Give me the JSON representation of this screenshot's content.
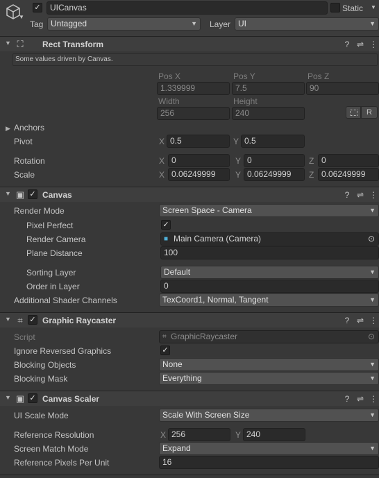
{
  "object": {
    "name": "UICanvas",
    "static_label": "Static",
    "tag_label": "Tag",
    "tag_value": "Untagged",
    "layer_label": "Layer",
    "layer_value": "UI"
  },
  "rect_transform": {
    "title": "Rect Transform",
    "notice": "Some values driven by Canvas.",
    "pos_x_label": "Pos X",
    "pos_y_label": "Pos Y",
    "pos_z_label": "Pos Z",
    "pos_x": "1.339999",
    "pos_y": "7.5",
    "pos_z": "90",
    "width_label": "Width",
    "height_label": "Height",
    "width": "256",
    "height": "240",
    "r_button": "R",
    "anchors_label": "Anchors",
    "pivot_label": "Pivot",
    "pivot_x": "0.5",
    "pivot_y": "0.5",
    "rotation_label": "Rotation",
    "rot_x": "0",
    "rot_y": "0",
    "rot_z": "0",
    "scale_label": "Scale",
    "scale_x": "0.06249999",
    "scale_y": "0.06249999",
    "scale_z": "0.06249999",
    "x": "X",
    "y": "Y",
    "z": "Z"
  },
  "canvas": {
    "title": "Canvas",
    "render_mode_label": "Render Mode",
    "render_mode": "Screen Space - Camera",
    "pixel_perfect_label": "Pixel Perfect",
    "render_camera_label": "Render Camera",
    "render_camera": "Main Camera (Camera)",
    "plane_distance_label": "Plane Distance",
    "plane_distance": "100",
    "sorting_layer_label": "Sorting Layer",
    "sorting_layer": "Default",
    "order_in_layer_label": "Order in Layer",
    "order_in_layer": "0",
    "shader_channels_label": "Additional Shader Channels",
    "shader_channels": "TexCoord1, Normal, Tangent"
  },
  "raycaster": {
    "title": "Graphic Raycaster",
    "script_label": "Script",
    "script": "GraphicRaycaster",
    "ignore_reversed_label": "Ignore Reversed Graphics",
    "blocking_objects_label": "Blocking Objects",
    "blocking_objects": "None",
    "blocking_mask_label": "Blocking Mask",
    "blocking_mask": "Everything"
  },
  "scaler": {
    "title": "Canvas Scaler",
    "ui_scale_mode_label": "UI Scale Mode",
    "ui_scale_mode": "Scale With Screen Size",
    "ref_resolution_label": "Reference Resolution",
    "ref_x": "256",
    "ref_y": "240",
    "match_mode_label": "Screen Match Mode",
    "match_mode": "Expand",
    "ref_ppu_label": "Reference Pixels Per Unit",
    "ref_ppu": "16"
  },
  "icons": {
    "checkmark": "✓",
    "dropdown_arrow": "▼",
    "help": "?",
    "presets": "⇌",
    "menu": "⋮",
    "fold_open": "▼",
    "fold_closed": "▶",
    "target": "⊙"
  }
}
